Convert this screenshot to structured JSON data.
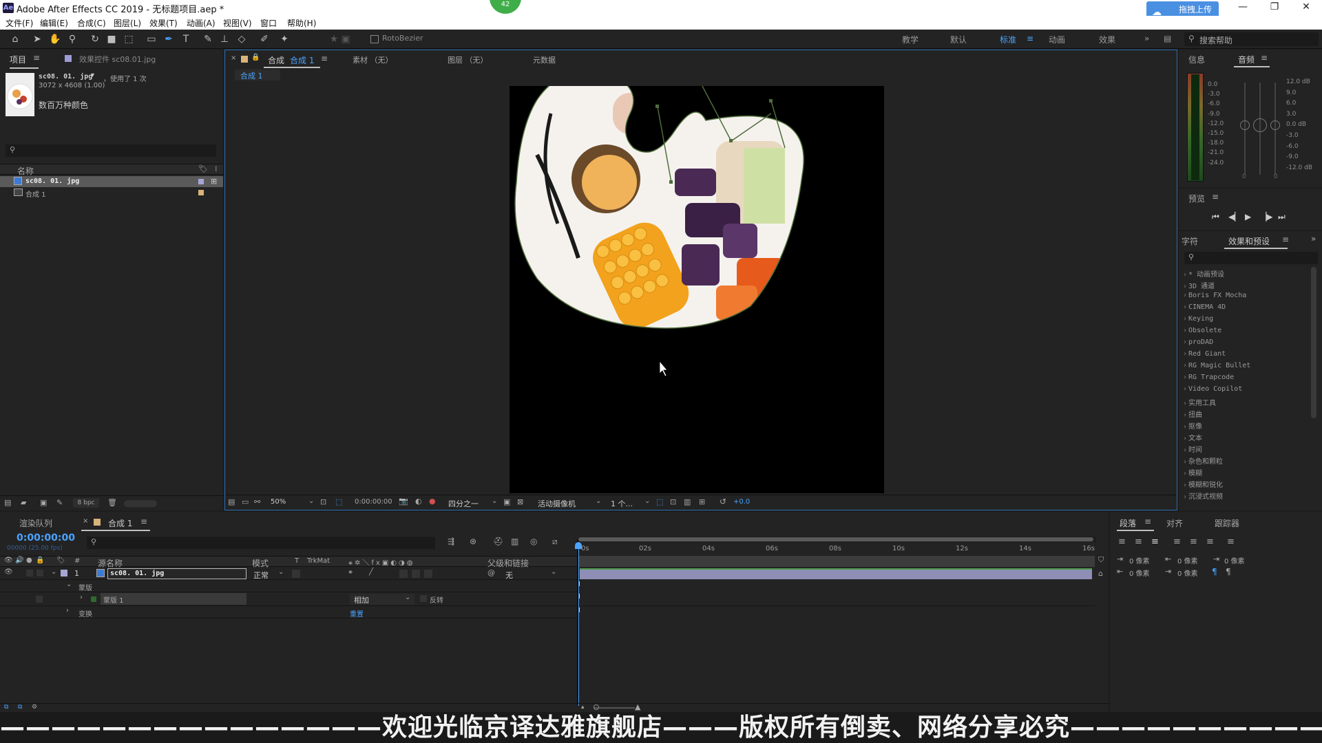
{
  "window": {
    "app_icon": "Ae",
    "title": "Adobe After Effects CC 2019 - 无标题项目.aep *",
    "badge": "42",
    "upload_button": "拖拽上传"
  },
  "menu": [
    "文件(F)",
    "编辑(E)",
    "合成(C)",
    "图层(L)",
    "效果(T)",
    "动画(A)",
    "视图(V)",
    "窗口",
    "帮助(H)"
  ],
  "toolbar": {
    "rotobezier": "RotoBezier",
    "workspaces": [
      "教学",
      "默认",
      "标准",
      "动画",
      "效果"
    ],
    "search_placeholder": "搜索帮助"
  },
  "project_panel": {
    "tab_project": "项目",
    "tab_effect_controls": "效果控件 sc08.01.jpg",
    "asset_name": "sc08. 01. jpg",
    "asset_used": "，使用了 1 次",
    "asset_dims": "3072 x 4608 (1.00)",
    "asset_colors": "数百万种颜色",
    "col_name": "名称",
    "items": [
      "sc08. 01. jpg",
      "合成 1"
    ],
    "bpc": "8 bpc"
  },
  "comp_panel": {
    "tab_comp": "合成",
    "tab_comp_name": "合成 1",
    "tab_footage": "素材 （无）",
    "tab_layer": "图层 （无）",
    "tab_meta": "元数据",
    "breadcrumb": "合成 1",
    "zoom": "50%",
    "timecode": "0:00:00:00",
    "resolution": "四分之一",
    "camera": "活动摄像机",
    "views": "1 个...",
    "exposure": "+0.0"
  },
  "info_panel": {
    "tab_info": "信息",
    "tab_audio": "音频",
    "db_left": [
      "0.0",
      "-3.0",
      "-6.0",
      "-9.0",
      "-12.0",
      "-15.0",
      "-18.0",
      "-21.0",
      "-24.0"
    ],
    "db_right": [
      "12.0 dB",
      "9.0",
      "6.0",
      "3.0",
      "0.0 dB",
      "-3.0",
      "-6.0",
      "-9.0",
      "-12.0 dB"
    ],
    "slider_zero_a": "0",
    "slider_zero_b": "0"
  },
  "preview_panel": {
    "tab": "预览"
  },
  "effects_panel": {
    "tab_char": "字符",
    "tab_effects": "效果和预设",
    "items": [
      "* 动画预设",
      "3D 通道",
      "Boris FX Mocha",
      "CINEMA 4D",
      "Keying",
      "Obsolete",
      "proDAD",
      "Red Giant",
      "RG Magic Bullet",
      "RG Trapcode",
      "Video Copilot",
      "实用工具",
      "扭曲",
      "抠像",
      "文本",
      "时间",
      "杂色和颗粒",
      "模糊",
      "模糊和锐化",
      "沉浸式视频"
    ]
  },
  "timeline": {
    "tab_render": "渲染队列",
    "tab_comp": "合成 1",
    "timecode": "0:00:00:00",
    "fps": "00000 (25.00 fps)",
    "col_num": "#",
    "col_source": "源名称",
    "col_mode": "模式",
    "col_t": "T",
    "col_trkmat": "TrkMat",
    "col_parent": "父级和链接",
    "layer_index": "1",
    "layer_name": "sc08. 01. jpg",
    "layer_mode": "正常",
    "layer_parent": "无",
    "mask_group": "蒙版",
    "mask_name": "蒙版 1",
    "mask_mode": "相加",
    "mask_invert": "反转",
    "transform": "变换",
    "reset": "重置",
    "ruler": [
      "0s",
      "02s",
      "04s",
      "06s",
      "08s",
      "10s",
      "12s",
      "14s",
      "16s"
    ]
  },
  "paragraph_panel": {
    "tab_para": "段落",
    "tab_align": "对齐",
    "tab_tracker": "跟踪器",
    "px_values": [
      "0 像素",
      "0 像素",
      "0 像素",
      "0 像素",
      "0 像素"
    ]
  },
  "banner": "———————————————欢迎光临京译达雅旗舰店———版权所有倒卖、网络分享必究———————————————"
}
